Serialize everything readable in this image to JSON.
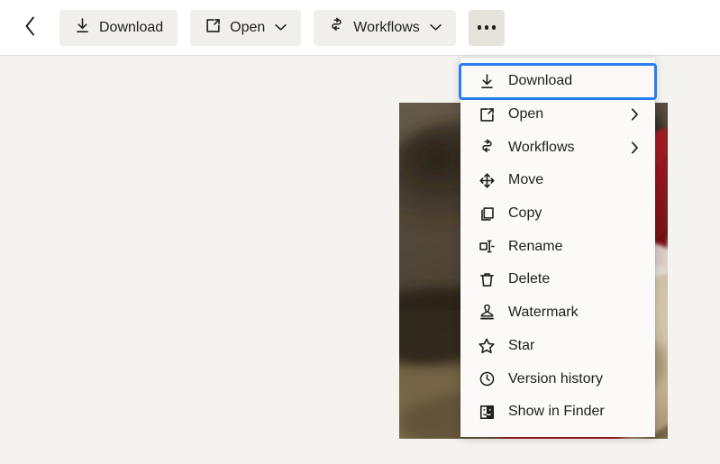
{
  "toolbar": {
    "back_icon": "chevron-left-icon",
    "buttons": [
      {
        "label": "Download",
        "icon": "download-icon",
        "caret": false
      },
      {
        "label": "Open",
        "icon": "external-link-icon",
        "caret": true
      },
      {
        "label": "Workflows",
        "icon": "workflows-icon",
        "caret": true
      }
    ],
    "more_label": "More options",
    "more_icon": "ellipsis-icon"
  },
  "menu": {
    "items": [
      {
        "label": "Download",
        "icon": "download-icon",
        "submenu": false,
        "focused": true
      },
      {
        "label": "Open",
        "icon": "external-link-icon",
        "submenu": true,
        "focused": false
      },
      {
        "label": "Workflows",
        "icon": "workflows-icon",
        "submenu": true,
        "focused": false
      },
      {
        "label": "Move",
        "icon": "move-icon",
        "submenu": false,
        "focused": false
      },
      {
        "label": "Copy",
        "icon": "copy-icon",
        "submenu": false,
        "focused": false
      },
      {
        "label": "Rename",
        "icon": "rename-icon",
        "submenu": false,
        "focused": false
      },
      {
        "label": "Delete",
        "icon": "trash-icon",
        "submenu": false,
        "focused": false
      },
      {
        "label": "Watermark",
        "icon": "stamp-icon",
        "submenu": false,
        "focused": false
      },
      {
        "label": "Star",
        "icon": "star-icon",
        "submenu": false,
        "focused": false
      },
      {
        "label": "Version history",
        "icon": "clock-icon",
        "submenu": false,
        "focused": false
      },
      {
        "label": "Show in Finder",
        "icon": "finder-icon",
        "submenu": false,
        "focused": false
      }
    ],
    "focus_color": "#2a7df0"
  },
  "preview": {
    "image_alt": "Photo of a dog wearing a red Santa hat",
    "image_name": "dog-santa-photo"
  },
  "colors": {
    "page_background": "#f4f3f0",
    "toolbar_background": "#ffffff",
    "button_background": "#f1efeb",
    "button_active_background": "#e6e2dc",
    "menu_background": "#fbfaf8",
    "text": "#1f1f1f",
    "accent": "#2a7df0"
  }
}
